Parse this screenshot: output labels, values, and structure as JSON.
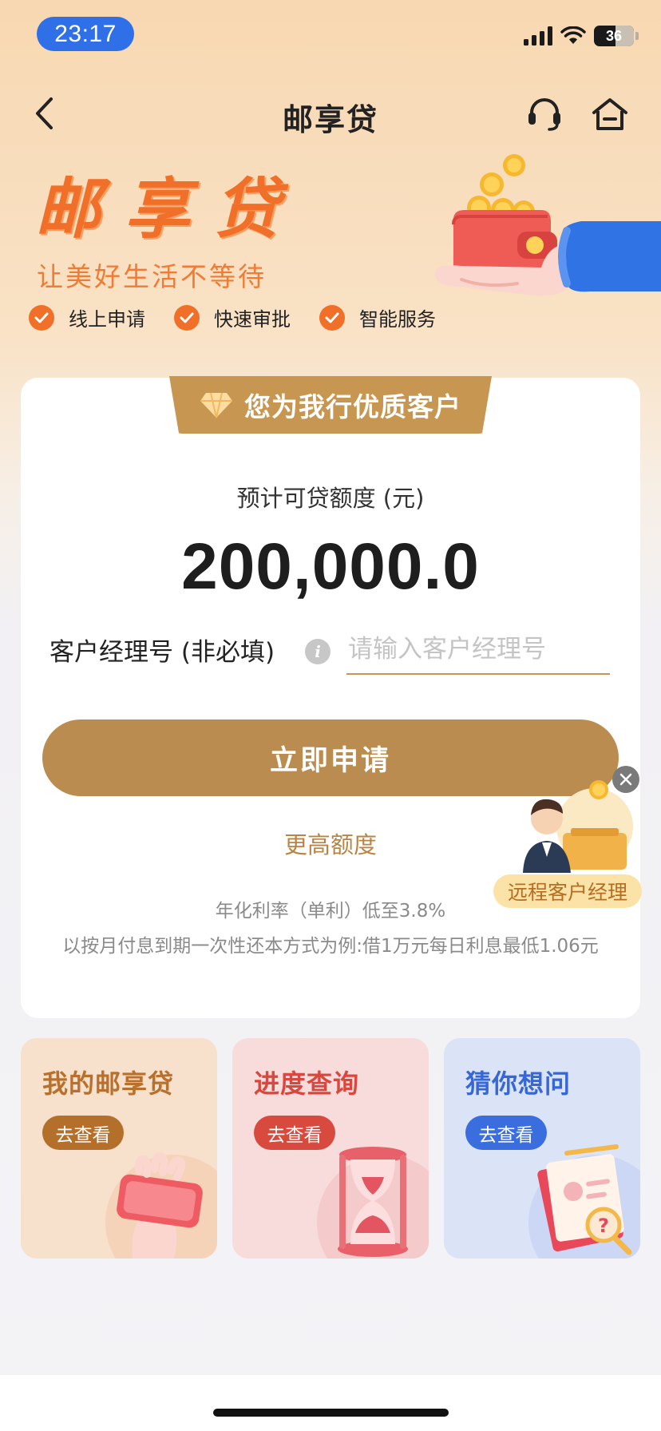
{
  "status_bar": {
    "time": "23:17",
    "battery": "36"
  },
  "nav": {
    "title": "邮享贷",
    "icons": [
      "back-icon",
      "headset-icon",
      "home-icon"
    ]
  },
  "hero": {
    "title": "邮享贷",
    "subtitle": "让美好生活不等待",
    "features": [
      "线上申请",
      "快速审批",
      "智能服务"
    ]
  },
  "card": {
    "vip_badge": "您为我行优质客户",
    "limit_label": "预计可贷额度 (元)",
    "limit_value": "200,000.0",
    "manager_label": "客户经理号 (非必填)",
    "manager_placeholder": "请输入客户经理号",
    "manager_value": "",
    "apply_button": "立即申请",
    "higher_limit_link": "更高额度",
    "rate_text": "年化利率（单利）低至3.8%",
    "example_text": "以按月付息到期一次性还本方式为例:借1万元每日利息最低1.06元"
  },
  "remote_manager": {
    "label": "远程客户经理"
  },
  "tiles": [
    {
      "title": "我的邮享贷",
      "button": "去查看"
    },
    {
      "title": "进度查询",
      "button": "去查看"
    },
    {
      "title": "猜你想问",
      "button": "去查看"
    }
  ],
  "colors": {
    "accent_orange": "#f0702a",
    "gold": "#bb8c4f",
    "status_pill": "#2f6fe8"
  }
}
